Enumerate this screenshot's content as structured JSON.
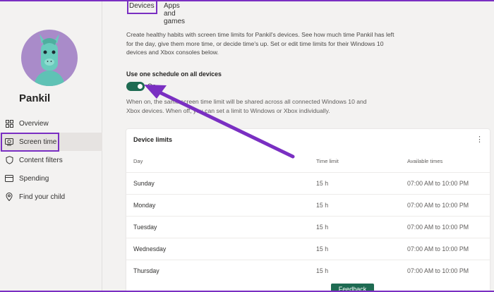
{
  "profile": {
    "name": "Pankil"
  },
  "sidebar": {
    "items": [
      {
        "label": "Overview",
        "icon": "grid-icon"
      },
      {
        "label": "Screen time",
        "icon": "laptop-clock-icon",
        "active": true
      },
      {
        "label": "Content filters",
        "icon": "shield-icon"
      },
      {
        "label": "Spending",
        "icon": "card-icon"
      },
      {
        "label": "Find your child",
        "icon": "location-pin-icon"
      }
    ]
  },
  "tabs": [
    {
      "label": "Devices",
      "active": true
    },
    {
      "label": "Apps and games"
    }
  ],
  "main": {
    "description": "Create healthy habits with screen time limits for Pankil's devices. See how much time Pankil has left for the day, give them more time, or decide time's up. Set or edit time limits for their Windows 10 devices and Xbox consoles below.",
    "schedule_label": "Use one schedule on all devices",
    "toggle_state": "On",
    "schedule_note": "When on, the same screen time limit will be shared across all connected Windows 10 and Xbox devices. When off, you can set a limit to Windows or Xbox individually."
  },
  "device_limits": {
    "title": "Device limits",
    "columns": [
      "Day",
      "Time limit",
      "Available times"
    ],
    "rows": [
      {
        "day": "Sunday",
        "limit": "15 h",
        "available": "07:00 AM to 10:00 PM"
      },
      {
        "day": "Monday",
        "limit": "15 h",
        "available": "07:00 AM to 10:00 PM"
      },
      {
        "day": "Tuesday",
        "limit": "15 h",
        "available": "07:00 AM to 10:00 PM"
      },
      {
        "day": "Wednesday",
        "limit": "15 h",
        "available": "07:00 AM to 10:00 PM"
      },
      {
        "day": "Thursday",
        "limit": "15 h",
        "available": "07:00 AM to 10:00 PM"
      }
    ]
  },
  "feedback_label": "Feedback",
  "colors": {
    "accent": "#1e6b52",
    "annotation": "#7a2fc2",
    "avatar_bg": "#a98bc9"
  }
}
